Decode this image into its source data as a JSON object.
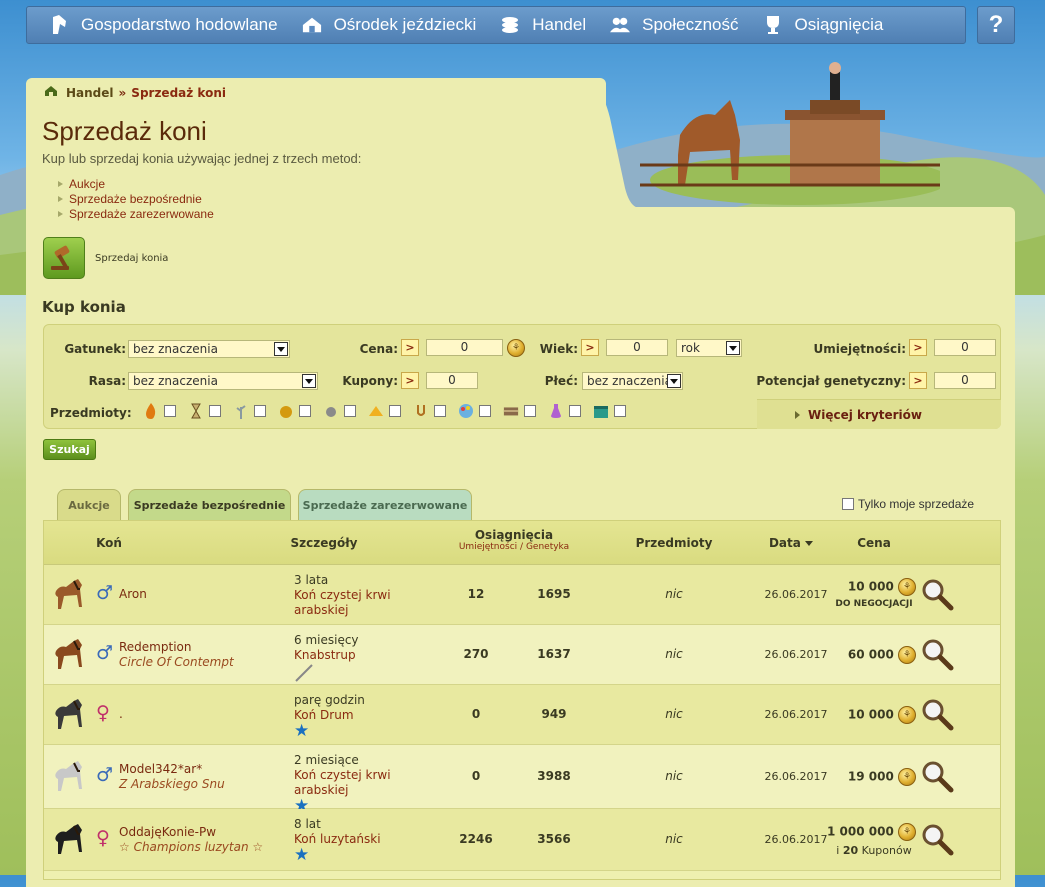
{
  "nav": {
    "items": [
      {
        "label": "Gospodarstwo hodowlane",
        "icon": "horse-head-icon"
      },
      {
        "label": "Ośrodek jeździecki",
        "icon": "stable-icon"
      },
      {
        "label": "Handel",
        "icon": "coins-icon"
      },
      {
        "label": "Społeczność",
        "icon": "people-icon"
      },
      {
        "label": "Osiągnięcia",
        "icon": "trophy-icon"
      }
    ],
    "help": "?"
  },
  "breadcrumb": {
    "root": "Handel",
    "sep": "»",
    "current": "Sprzedaż koni"
  },
  "page": {
    "title": "Sprzedaż koni",
    "subtitle": "Kup lub sprzedaj konia używając jednej z trzech metod:",
    "methods": [
      "Aukcje",
      "Sprzedaże bezpośrednie",
      "Sprzedaże zarezerwowane"
    ],
    "sell_label": "Sprzedaj konia",
    "buy_title": "Kup konia"
  },
  "filters": {
    "breed_label": "Gatunek:",
    "breed_value": "bez znaczenia",
    "price_label": "Cena:",
    "price_op": ">",
    "price_value": "0",
    "age_label": "Wiek:",
    "age_op": ">",
    "age_value": "0",
    "age_unit": "rok",
    "skills_label": "Umiejętności:",
    "skills_op": ">",
    "skills_value": "0",
    "race_label": "Rasa:",
    "race_value": "bez znaczenia",
    "coupons_label": "Kupony:",
    "coupons_op": ">",
    "coupons_value": "0",
    "sex_label": "Płeć:",
    "sex_value": "bez znaczenia",
    "genetic_label": "Potencjał genetyczny:",
    "genetic_op": ">",
    "genetic_value": "0",
    "items_label": "Przedmioty:",
    "items": [
      "fire-icon",
      "hourglass-icon",
      "plant-icon",
      "apple-icon",
      "stone-icon",
      "cheese-icon",
      "horseshoe-icon",
      "palette-icon",
      "chest-icon",
      "potion-icon",
      "box-icon"
    ],
    "more_label": "Więcej kryteriów",
    "search_label": "Szukaj"
  },
  "tabs": [
    {
      "label": "Aukcje"
    },
    {
      "label": "Sprzedaże bezpośrednie"
    },
    {
      "label": "Sprzedaże zarezerwowane"
    }
  ],
  "only_mine_label": "Tylko moje sprzedaże",
  "table": {
    "headers": {
      "horse": "Koń",
      "details": "Szczegóły",
      "achievements": "Osiągnięcia",
      "skills": "Umiejętności",
      "slash": "/",
      "genetics": "Genetyka",
      "items": "Przedmioty",
      "date": "Data",
      "price": "Cena"
    },
    "rows": [
      {
        "sex": "♂",
        "name": "Aron",
        "affix": "",
        "age": "3 lata",
        "breed": "Koń czystej krwi arabskiej",
        "skills": "12",
        "genetics": "1695",
        "items": "nic",
        "date": "26.06.2017",
        "price": "10 000",
        "extra": "DO NEGOCJACJI",
        "coat": "#9a5a2a",
        "star": false,
        "tool": false
      },
      {
        "sex": "♂",
        "name": "Redemption",
        "affix": "Circle Of Contempt",
        "age": "6 miesięcy",
        "breed": "Knabstrup",
        "skills": "270",
        "genetics": "1637",
        "items": "nic",
        "date": "26.06.2017",
        "price": "60 000",
        "extra": "",
        "coat": "#8a4a1e",
        "star": false,
        "tool": true
      },
      {
        "sex": "♀",
        "name": ".",
        "affix": "",
        "age": "parę godzin",
        "breed": "Koń Drum",
        "skills": "0",
        "genetics": "949",
        "items": "nic",
        "date": "26.06.2017",
        "price": "10 000",
        "extra": "",
        "coat": "#3a3a3a",
        "star": true,
        "tool": false
      },
      {
        "sex": "♂",
        "name": "Model342*ar*",
        "affix": "Z Arabskiego Snu",
        "age": "2 miesiące",
        "breed": "Koń czystej krwi arabskiej",
        "skills": "0",
        "genetics": "3988",
        "items": "nic",
        "date": "26.06.2017",
        "price": "19 000",
        "extra": "",
        "coat": "#c8c8c8",
        "star": true,
        "tool": false
      },
      {
        "sex": "♀",
        "name": "OddajęKonie-Pw",
        "affix": "☆ Champions luzytan ☆",
        "age": "8 lat",
        "breed": "Koń luzytański",
        "skills": "2246",
        "genetics": "3566",
        "items": "nic",
        "date": "26.06.2017",
        "price": "1 000 000",
        "extra_pre": "i",
        "extra_num": "20",
        "extra_post": "Kuponów",
        "coat": "#1e1e1e",
        "star": true,
        "tool": false
      }
    ]
  },
  "colors": {
    "male": "#3a6ab8",
    "female": "#c0306a",
    "accent": "#8a2a10"
  }
}
